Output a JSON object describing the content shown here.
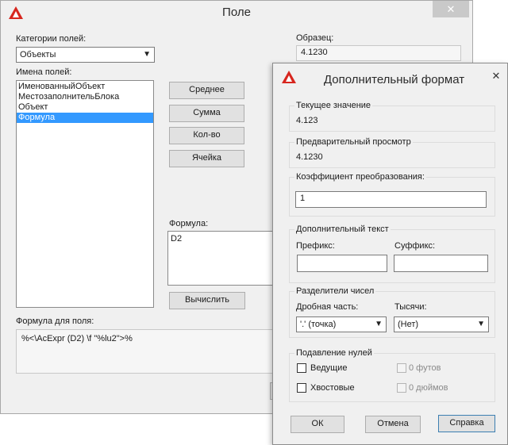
{
  "main_dialog": {
    "title": "Поле",
    "close_glyph": "✕",
    "field_categories_label": "Категории полей:",
    "field_categories_value": "Объекты",
    "field_names_label": "Имена полей:",
    "field_names": [
      "ИменованныйОбъект",
      "МестозаполнительБлока",
      "Объект",
      "Формула"
    ],
    "selected_field_index": 3,
    "sample_label": "Образец:",
    "sample_value": "4.1230",
    "buttons": {
      "average": "Среднее",
      "sum": "Сумма",
      "count": "Кол-во",
      "cell": "Ячейка",
      "evaluate": "Вычислить"
    },
    "formula_label": "Формула:",
    "formula_value": "D2",
    "field_expression_label": "Формула для поля:",
    "field_expression_value": "%<\\AcExpr (D2) \\f \"%lu2\">%"
  },
  "additional_format": {
    "title": "Дополнительный формат",
    "close_glyph": "✕",
    "current_value_label": "Текущее значение",
    "current_value": "4.123",
    "preview_label": "Предварительный просмотр",
    "preview_value": "4.1230",
    "conversion_factor_label": "Коэффициент преобразования:",
    "conversion_factor_value": "1",
    "additional_text_label": "Дополнительный текст",
    "prefix_label": "Префикс:",
    "prefix_value": "",
    "suffix_label": "Суффикс:",
    "suffix_value": "",
    "number_separators_label": "Разделители чисел",
    "decimal_label": "Дробная часть:",
    "decimal_value": "'.' (точка)",
    "thousands_label": "Тысячи:",
    "thousands_value": "(Нет)",
    "zero_suppression_label": "Подавление нулей",
    "leading_label": "Ведущие",
    "trailing_label": "Хвостовые",
    "zero_feet_label": "0 футов",
    "zero_inches_label": "0 дюймов",
    "ok_label": "ОК",
    "cancel_label": "Отмена",
    "help_label": "Справка"
  },
  "colors": {
    "accent": "#3399ff",
    "logo_red": "#d7261e"
  },
  "icons": {
    "app_logo": "autocad-logo-icon",
    "dropdown": "chevron-down-icon",
    "close": "close-icon"
  }
}
